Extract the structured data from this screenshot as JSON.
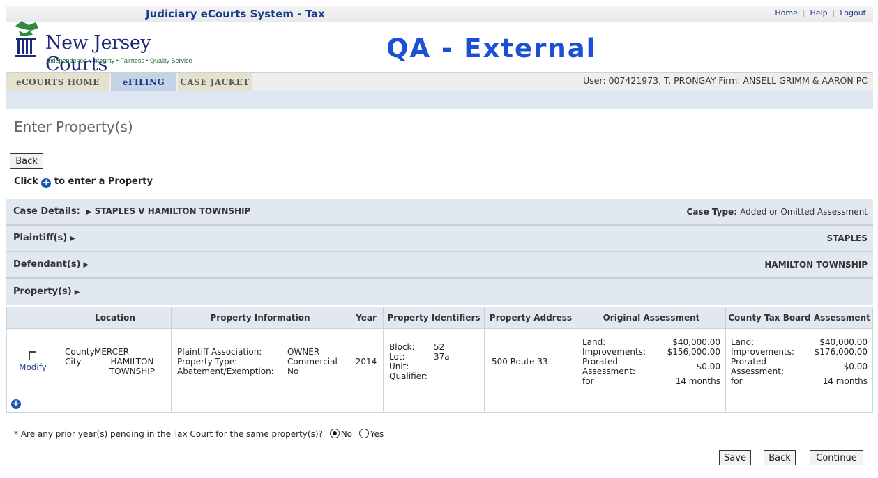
{
  "header": {
    "system_title": "Judiciary eCourts System - Tax",
    "links": [
      "Home",
      "Help",
      "Logout"
    ],
    "logo_text": "New Jersey Courts",
    "logo_tagline": "Independence • Integrity • Fairness • Quality Service",
    "environment": "QA - External",
    "user_info": "User: 007421973, T. PRONGAY  Firm: ANSELL GRIMM & AARON PC"
  },
  "nav": {
    "tabs": [
      "eCOURTS HOME",
      "eFILING",
      "CASE JACKET"
    ],
    "active": "eFILING"
  },
  "page": {
    "title": "Enter Property(s)",
    "back_label": "Back",
    "hint_prefix": "Click",
    "hint_suffix": "to enter a Property"
  },
  "sections": {
    "case_details_label": "Case Details:",
    "case_name": "STAPLES V HAMILTON TOWNSHIP",
    "case_type_label": "Case Type:",
    "case_type_value": "Added or Omitted Assessment",
    "plaintiff_label": "Plaintiff(s)",
    "plaintiff_value": "STAPLES",
    "defendant_label": "Defendant(s)",
    "defendant_value": "HAMILTON TOWNSHIP",
    "property_label": "Property(s)"
  },
  "table": {
    "headers": [
      "Location",
      "Property Information",
      "Year",
      "Property Identifiers",
      "Property Address",
      "Original Assessment",
      "County Tax Board Assessment"
    ],
    "row": {
      "modify_label": "Modify",
      "county_label": "County:",
      "county_value": "MERCER",
      "city_label": "City",
      "city_value": "HAMILTON TOWNSHIP",
      "assoc_label": "Plaintiff Association:",
      "assoc_value": "OWNER",
      "type_label": "Property Type:",
      "type_value": "Commercial",
      "abate_label": "Abatement/Exemption:",
      "abate_value": "No",
      "year": "2014",
      "block_label": "Block:",
      "block_value": "52",
      "lot_label": "Lot:",
      "lot_value": "37a",
      "unit_label": "Unit:",
      "qualifier_label": "Qualifier:",
      "address": "500 Route 33",
      "orig": {
        "land_label": "Land:",
        "land": "$40,000.00",
        "impr_label": "Improvements:",
        "impr": "$156,000.00",
        "prorated_label": "Prorated Assessment:",
        "prorated": "$0.00",
        "for_label": "for",
        "for_value": "14 months"
      },
      "ctb": {
        "land_label": "Land:",
        "land": "$40,000.00",
        "impr_label": "Improvements:",
        "impr": "$176,000.00",
        "prorated_label": "Prorated Assessment:",
        "prorated": "$0.00",
        "for_label": "for",
        "for_value": "14 months"
      }
    }
  },
  "question": {
    "required_mark": "*",
    "text": "Are any prior year(s) pending in the Tax Court for the same property(s)?",
    "option_no": "No",
    "option_yes": "Yes",
    "selected": "No"
  },
  "footer_buttons": {
    "save": "Save",
    "back": "Back",
    "continue": "Continue"
  }
}
